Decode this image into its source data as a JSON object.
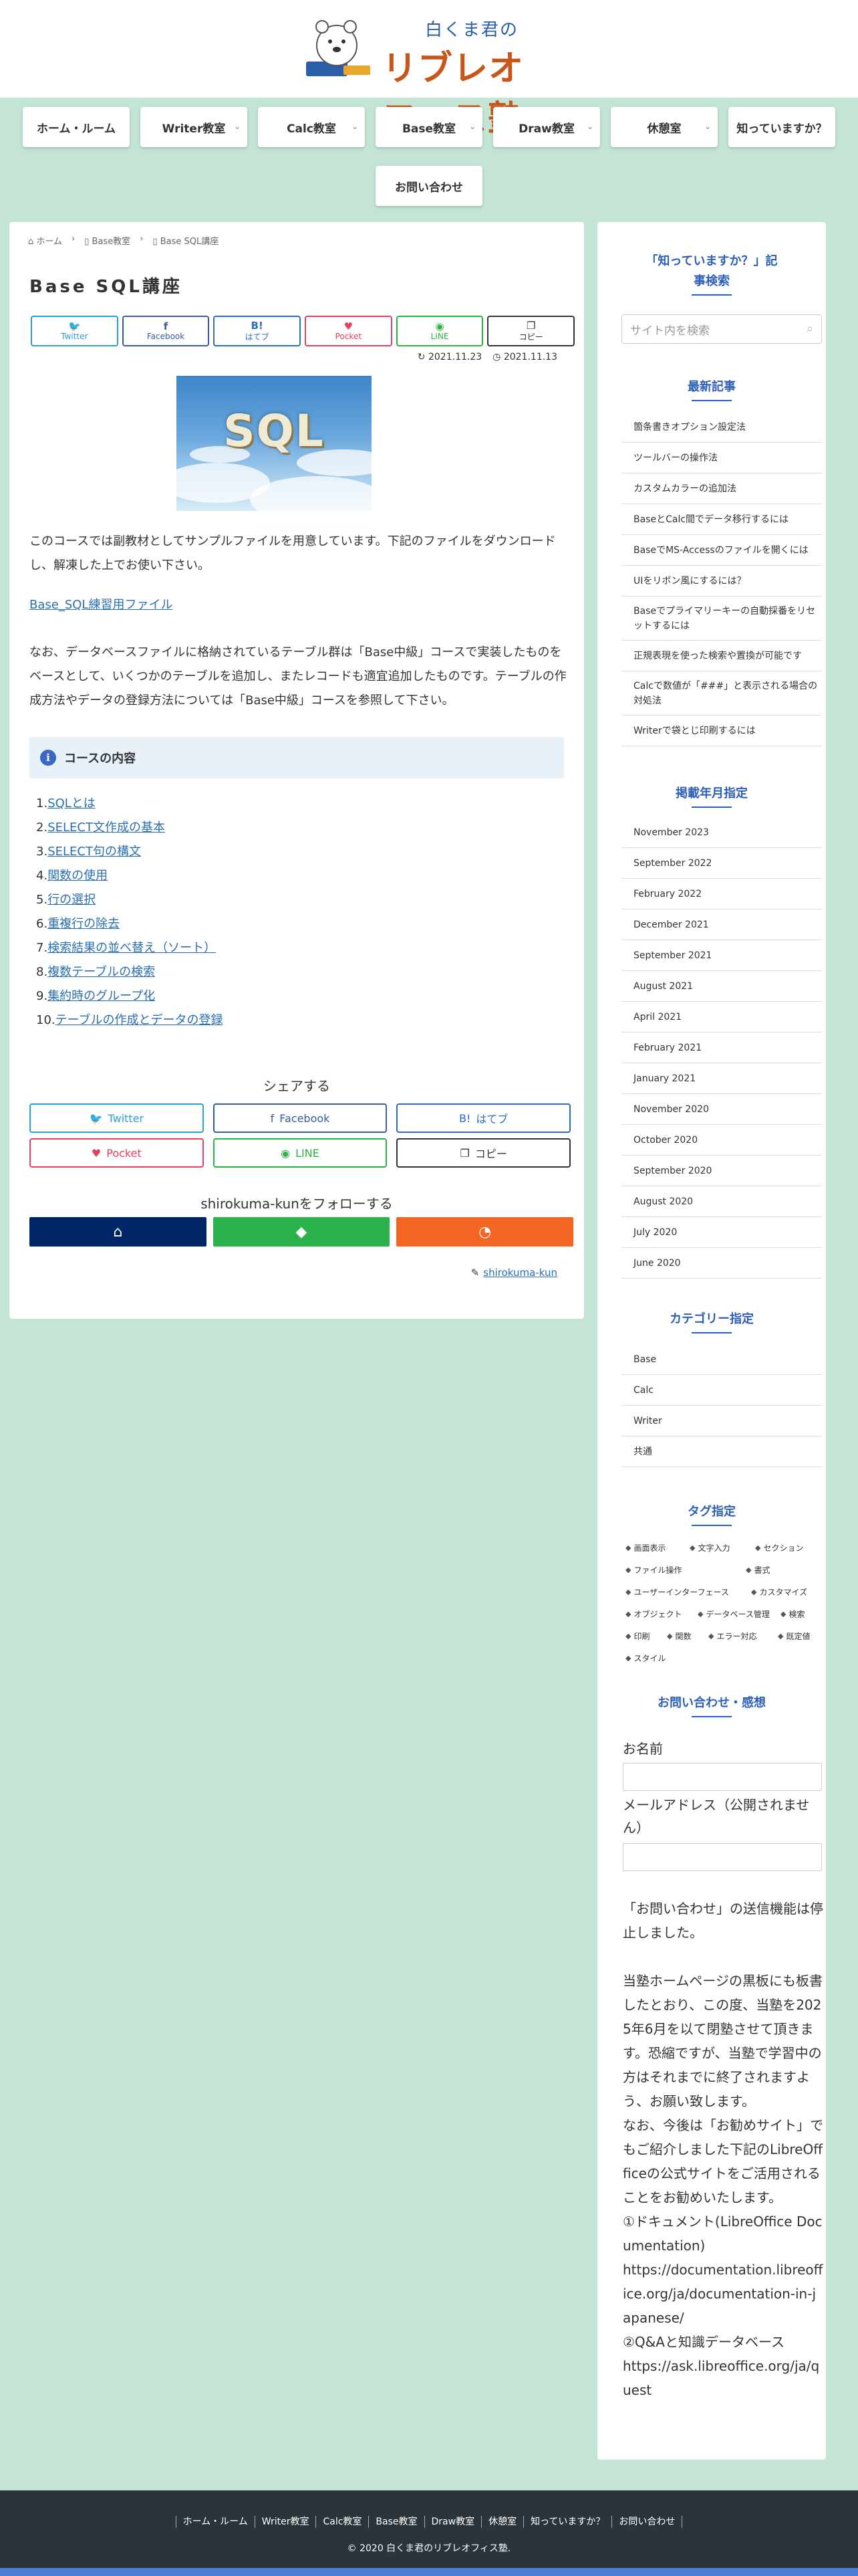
{
  "header": {
    "logo_sub": "白くま君の",
    "logo_main": "リブレオフィス塾"
  },
  "nav": {
    "items": [
      {
        "label": "ホーム・ルーム",
        "dropdown": false
      },
      {
        "label": "Writer教室",
        "dropdown": true
      },
      {
        "label": "Calc教室",
        "dropdown": true
      },
      {
        "label": "Base教室",
        "dropdown": true
      },
      {
        "label": "Draw教室",
        "dropdown": true
      },
      {
        "label": "休憩室",
        "dropdown": true
      },
      {
        "label": "知っていますか？",
        "dropdown": false
      },
      {
        "label": "お問い合わせ",
        "dropdown": false
      }
    ]
  },
  "breadcrumb": [
    "ホーム",
    "Base教室",
    "Base SQL講座"
  ],
  "article": {
    "title": "Base SQL講座",
    "share_top": [
      {
        "label": "Twitter",
        "icon": "twitter-icon",
        "color": "#2a9fd6"
      },
      {
        "label": "Facebook",
        "icon": "facebook-icon",
        "color": "#3b5b9a"
      },
      {
        "label": "はてブ",
        "icon": "hatena-icon",
        "color": "#2c6ebd"
      },
      {
        "label": "Pocket",
        "icon": "pocket-icon",
        "color": "#e4405f"
      },
      {
        "label": "LINE",
        "icon": "line-icon",
        "color": "#28b443"
      },
      {
        "label": "コピー",
        "icon": "copy-icon",
        "color": "#333333"
      }
    ],
    "updated": "2021.11.23",
    "published": "2021.11.13",
    "eyecatch_text": "SQL",
    "intro": "このコースでは副教材としてサンプルファイルを用意しています。下記のファイルをダウンロードし、解凍した上でお使い下さい。",
    "download_link": "Base_SQL練習用ファイル",
    "body": "なお、データベースファイルに格納されているテーブル群は「Base中級」コースで実装したものをベースとして、いくつかのテーブルを追加し、またレコードも適宜追加したものです。テーブルの作成方法やデータの登録方法については「Base中級」コースを参照して下さい。",
    "course_box_title": "コースの内容",
    "toc": [
      {
        "num": "1.",
        "label": "SQLとは"
      },
      {
        "num": "2.",
        "label": "SELECT文作成の基本"
      },
      {
        "num": "3.",
        "label": "SELECT句の構文"
      },
      {
        "num": "4.",
        "label": "関数の使用"
      },
      {
        "num": "5.",
        "label": "行の選択"
      },
      {
        "num": "6.",
        "label": "重複行の除去"
      },
      {
        "num": "7.",
        "label": "検索結果の並べ替え（ソート）"
      },
      {
        "num": "8.",
        "label": "複数テーブルの検索"
      },
      {
        "num": "9.",
        "label": "集約時のグループ化"
      },
      {
        "num": "10.",
        "label": "テーブルの作成とデータの登録"
      }
    ],
    "share_heading": "シェアする",
    "share_bottom": [
      {
        "label": "Twitter",
        "icon": "twitter-icon",
        "color": "#2a9fd6"
      },
      {
        "label": "Facebook",
        "icon": "facebook-icon",
        "color": "#3b5b9a"
      },
      {
        "label": "はてブ",
        "icon": "hatena-icon",
        "color": "#2c6ebd"
      },
      {
        "label": "Pocket",
        "icon": "pocket-icon",
        "color": "#e4405f"
      },
      {
        "label": "LINE",
        "icon": "line-icon",
        "color": "#28b443"
      },
      {
        "label": "コピー",
        "icon": "copy-icon",
        "color": "#333333"
      }
    ],
    "follow_heading": "shirokuma-kunをフォローする",
    "follow_buttons": [
      {
        "icon": "home-icon",
        "color": "#002567"
      },
      {
        "icon": "feedly-icon",
        "color": "#2bb24c"
      },
      {
        "icon": "rss-icon",
        "color": "#f26522"
      }
    ],
    "author": "shirokuma-kun"
  },
  "sidebar": {
    "search_title_1": "「知っていますか？」記",
    "search_title_2": "事検索",
    "search_placeholder": "サイト内を検索",
    "recent_title": "最新記事",
    "recent": [
      "箇条書きオプション設定法",
      "ツールバーの操作法",
      "カスタムカラーの追加法",
      "BaseとCalc間でデータ移行するには",
      "BaseでMS-Accessのファイルを開くには",
      "UIをリボン風にするには？",
      "Baseでプライマリーキーの自動採番をリセットするには",
      "正規表現を使った検索や置換が可能です",
      "Calcで数値が「###」と表示される場合の対処法",
      "Writerで袋とじ印刷するには"
    ],
    "archive_title": "掲載年月指定",
    "archives": [
      "November 2023",
      "September 2022",
      "February 2022",
      "December 2021",
      "September 2021",
      "August 2021",
      "April 2021",
      "February 2021",
      "January 2021",
      "November 2020",
      "October 2020",
      "September 2020",
      "August 2020",
      "July 2020",
      "June 2020"
    ],
    "category_title": "カテゴリー指定",
    "categories": [
      "Base",
      "Calc",
      "Writer",
      "共通"
    ],
    "tag_title": "タグ指定",
    "tags": [
      "画面表示",
      "文字入力",
      "セクション",
      "ファイル操作",
      "書式",
      "ユーザーインターフェース",
      "カスタマイズ",
      "オブジェクト",
      "データベース管理",
      "検索",
      "印刷",
      "関数",
      "エラー対応",
      "既定値",
      "スタイル"
    ],
    "contact_title": "お問い合わせ・感想",
    "name_label": "お名前",
    "email_label_1": "メールアドレス（公開されませ",
    "email_label_2": "ん）",
    "notice_lines": [
      "「お問い合わせ」の送信機能は停止しました。",
      "",
      "当塾ホームページの黒板にも板書したとおり、この度、当塾を2025年6月を以て閉塾させて頂きます。恐縮ですが、当塾で学習中の方はそれまでに終了されますよう、お願い致します。",
      "なお、今後は「お勧めサイト」でもご紹介しました下記のLibreOffficeの公式サイトをご活用されることをお勧めいたします。",
      "①ドキュメント(LibreOffice Documentation)",
      "https://documentation.libreoffice.org/ja/documentation-in-japanese/",
      "②Q&Aと知識データベース",
      "https://ask.libreoffice.org/ja/quest"
    ]
  },
  "footer": {
    "nav": [
      "ホーム・ルーム",
      "Writer教室",
      "Calc教室",
      "Base教室",
      "Draw教室",
      "休憩室",
      "知っていますか？",
      "お問い合わせ"
    ],
    "copyright": "© 2020 白くま君のリブレオフィス塾."
  }
}
